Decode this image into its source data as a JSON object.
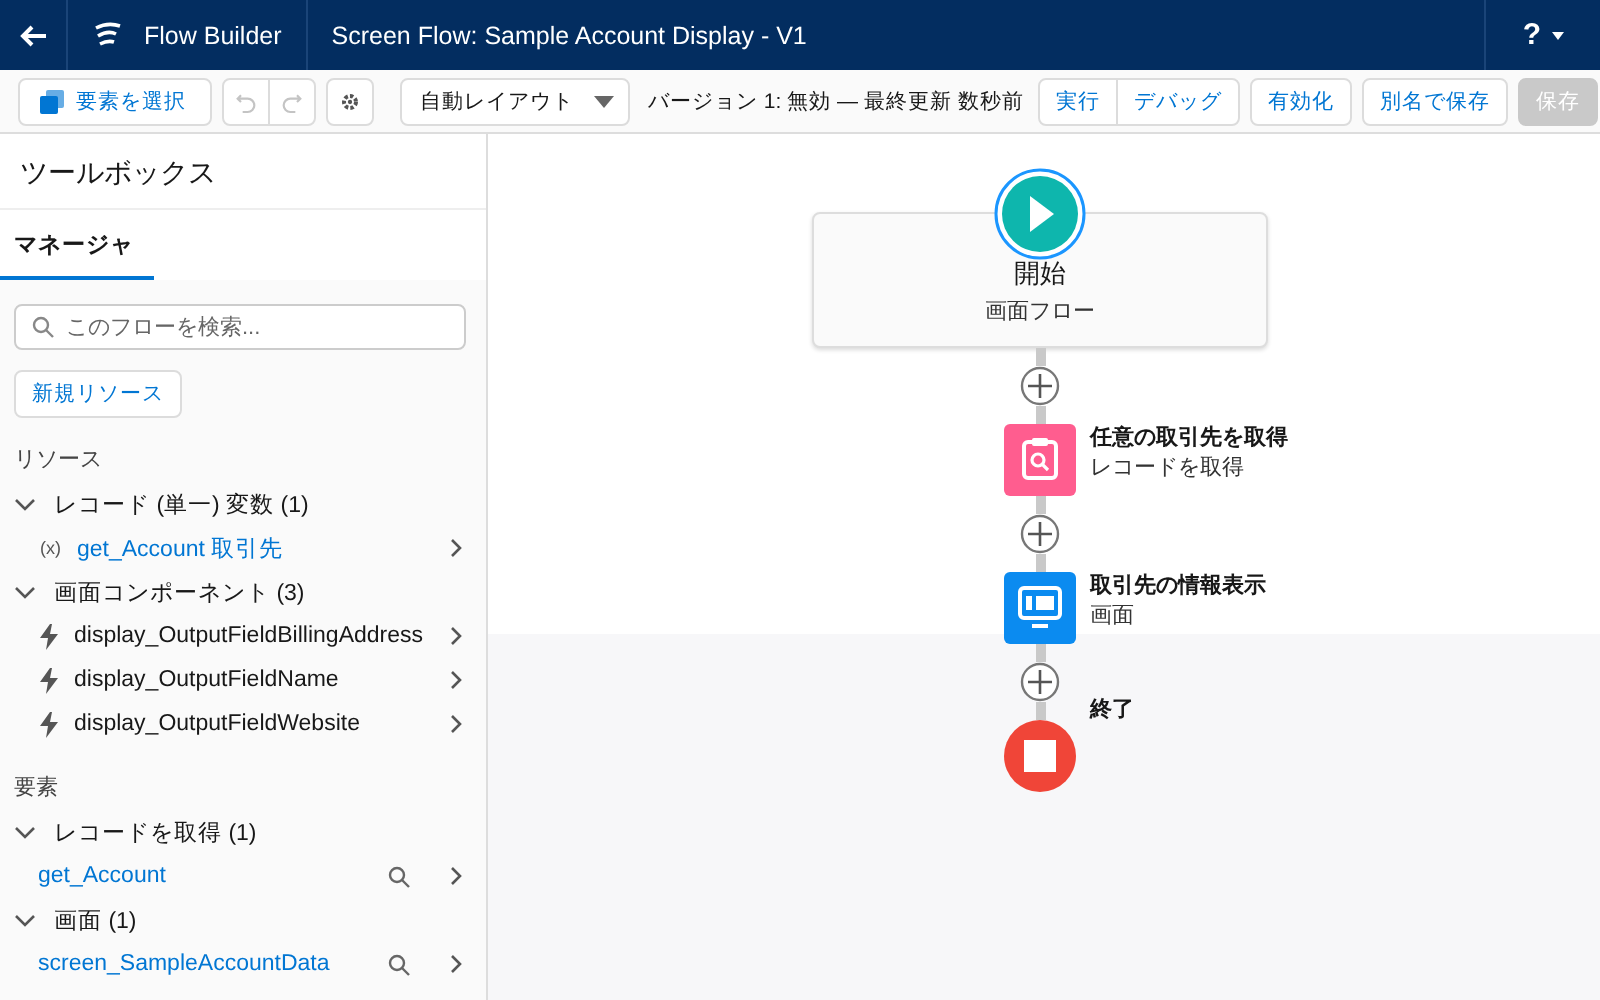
{
  "header": {
    "app_name": "Flow Builder",
    "title": "Screen Flow: Sample Account Display - V1",
    "help": "?"
  },
  "toolbar": {
    "select_button": "要素を選択",
    "undo_disabled": true,
    "redo_disabled": true,
    "layout": "自動レイアウト",
    "status": "バージョン 1: 無効 — 最終更新 数秒前",
    "button_groups": [
      [
        {
          "label": "実行",
          "disabled": false
        },
        {
          "label": "デバッグ",
          "disabled": false
        }
      ],
      [
        {
          "label": "有効化",
          "disabled": false
        }
      ],
      [
        {
          "label": "別名で保存",
          "disabled": false
        }
      ],
      [
        {
          "label": "保存",
          "disabled": true
        }
      ]
    ]
  },
  "sidebar": {
    "title": "ツールボックス",
    "tabs": [
      {
        "label": "マネージャ",
        "selected": true
      }
    ],
    "search": {
      "placeholder": "このフローを検索..."
    },
    "new_resource": "新規リソース",
    "sections": [
      {
        "heading": "リソース",
        "groups": [
          {
            "label": "レコード (単一) 変数 (1)",
            "expanded": true,
            "items": [
              {
                "kind": "variable",
                "icon": "(x)",
                "label": "get_Account 取引先"
              }
            ]
          },
          {
            "label": "画面コンポーネント (3)",
            "expanded": true,
            "items": [
              {
                "kind": "component",
                "label": "display_OutputFieldBillingAddress"
              },
              {
                "kind": "component",
                "label": "display_OutputFieldName"
              },
              {
                "kind": "component",
                "label": "display_OutputFieldWebsite"
              }
            ]
          }
        ]
      },
      {
        "heading": "要素",
        "groups": [
          {
            "label": "レコードを取得 (1)",
            "expanded": true,
            "items": [
              {
                "kind": "element",
                "label": "get_Account"
              }
            ]
          },
          {
            "label": "画面 (1)",
            "expanded": true,
            "items": [
              {
                "kind": "element",
                "label": "screen_SampleAccountData"
              }
            ]
          }
        ]
      }
    ]
  },
  "canvas": {
    "nodes": [
      {
        "kind": "start",
        "title": "開始",
        "subtitle": "画面フロー"
      },
      {
        "kind": "get_records",
        "title": "任意の取引先を取得",
        "subtitle": "レコードを取得"
      },
      {
        "kind": "screen",
        "title": "取引先の情報表示",
        "subtitle": "画面"
      },
      {
        "kind": "end",
        "title": "終了"
      }
    ]
  }
}
